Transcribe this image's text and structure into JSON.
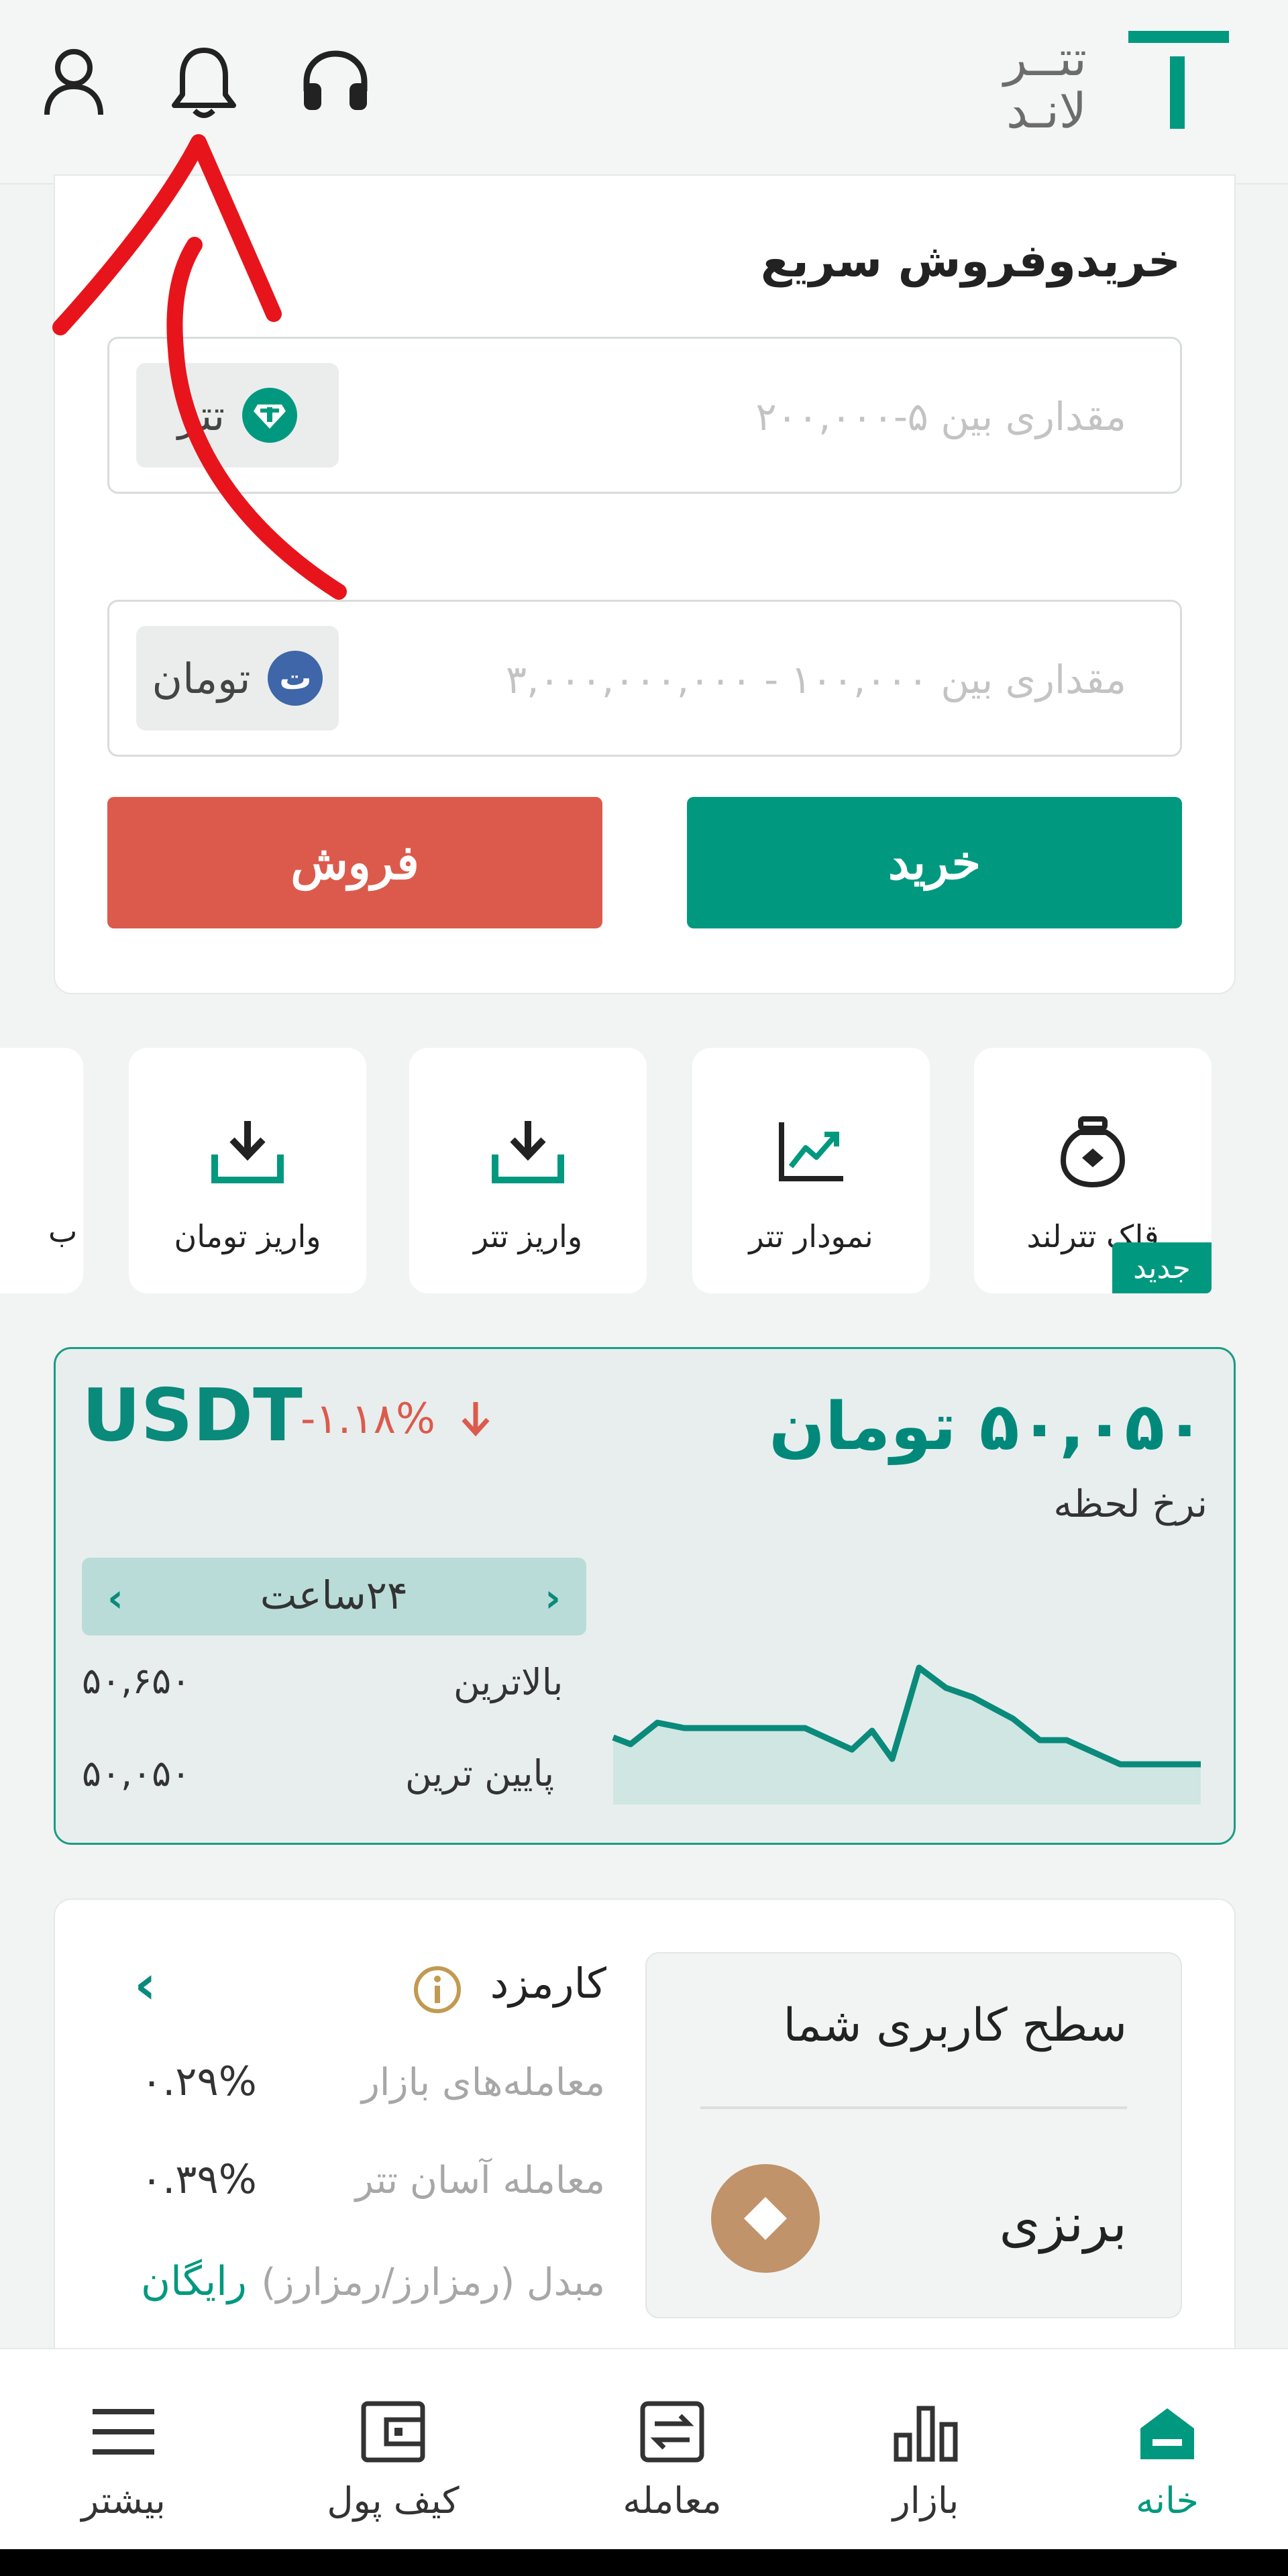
{
  "header": {
    "logo_text_top": "تتــر",
    "logo_text_bottom": "لانـد",
    "icons": [
      "user-icon",
      "bell-icon",
      "headset-icon"
    ]
  },
  "quick_trade": {
    "title": "خریدوفروش سریع",
    "tether_field": {
      "placeholder": "مقداری بین ۵-۲۰۰,۰۰۰",
      "unit": "تتر"
    },
    "toman_field": {
      "placeholder": "مقداری بین ۱۰۰,۰۰۰ - ۳,۰۰۰,۰۰۰,۰۰۰",
      "unit": "تومان",
      "unit_glyph": "ت"
    },
    "buy_label": "خرید",
    "sell_label": "فروش"
  },
  "shortcuts": [
    {
      "label": "قلک تترلند",
      "icon": "piggy-jar-icon",
      "badge": "جدید"
    },
    {
      "label": "نمودار تتر",
      "icon": "chart-icon"
    },
    {
      "label": "واریز تتر",
      "icon": "deposit-icon"
    },
    {
      "label": "واریز تومان",
      "icon": "deposit-icon"
    },
    {
      "label": "ب",
      "icon": ""
    }
  ],
  "price": {
    "value": "۵۰,۰۵۰ تومان",
    "label": "نرخ لحظه",
    "symbol": "USDT",
    "change": "-۱.۱۸%",
    "period": "۲۴ساعت",
    "high_label": "بالاترین",
    "high_value": "۵۰,۶۵۰",
    "low_label": "پایین ترین",
    "low_value": "۵۰,۰۵۰",
    "colors": {
      "accent": "#00997f",
      "down": "#dc5a4c"
    }
  },
  "fees": {
    "title": "کارمزد",
    "rows": [
      {
        "label": "معامله‌های بازار",
        "value": "۰.۲۹%"
      },
      {
        "label": "معامله آسان تتر",
        "value": "۰.۳۹%"
      },
      {
        "label": "مبدل (رمزارز/رمزارز)",
        "value": "رایگان"
      }
    ]
  },
  "user_level": {
    "title": "سطح کاربری شما",
    "value": "برنزی"
  },
  "nav": [
    {
      "label": "خانه",
      "icon": "home-icon",
      "active": true
    },
    {
      "label": "بازار",
      "icon": "bar-chart-icon"
    },
    {
      "label": "معامله",
      "icon": "exchange-icon"
    },
    {
      "label": "کیف پول",
      "icon": "wallet-icon"
    },
    {
      "label": "بیشتر",
      "icon": "menu-icon"
    }
  ]
}
